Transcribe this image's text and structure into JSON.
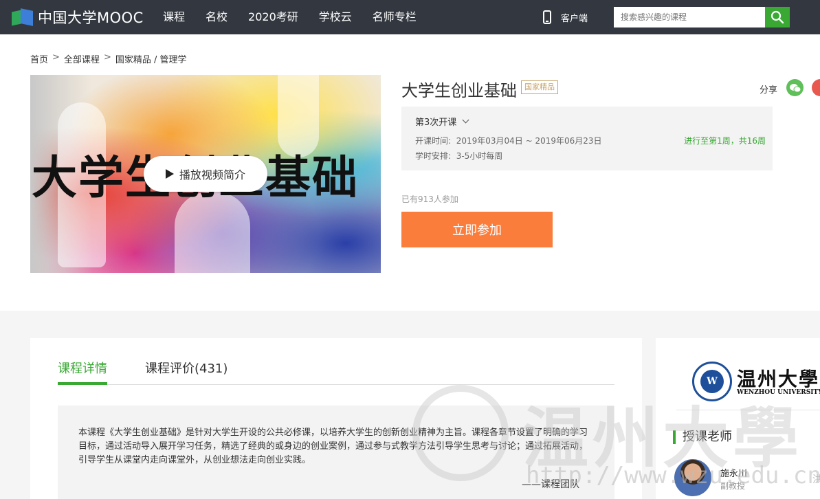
{
  "header": {
    "logo_text": "中国大学MOOC",
    "nav": [
      "课程",
      "名校",
      "2020考研",
      "学校云",
      "名师专栏"
    ],
    "client_label": "客户端",
    "search_placeholder": "搜索感兴趣的课程"
  },
  "breadcrumb": {
    "home": "首页",
    "all_courses": "全部课程",
    "category": "国家精品 / 管理学"
  },
  "cover": {
    "title_text": "大学生创业基础",
    "play_label": "播放视频简介"
  },
  "course": {
    "title": "大学生创业基础",
    "badge": "国家精品",
    "share_label": "分享",
    "term": "第3次开课",
    "start_time_label": "开课时间:",
    "start_time_value": "2019年03月04日 ~ 2019年06月23日",
    "schedule_label": "学时安排:",
    "schedule_value": "3-5小时每周",
    "progress": "进行至第1周，共16周",
    "enrolled": "已有913人参加",
    "join_label": "立即参加"
  },
  "tabs": [
    "课程详情",
    "课程评价(431)"
  ],
  "description": {
    "text": "本课程《大学生创业基础》是针对大学生开设的公共必修课，以培养大学生的创新创业精神为主旨。课程各章节设置了明确的学习目标，通过活动导入展开学习任务，精选了经典的或身边的创业案例，通过参与式教学方法引导学生思考与讨论；通过拓展活动，引导学生从课堂内走向课堂外，从创业想法走向创业实践。",
    "signature": "——课程团队"
  },
  "sidebar": {
    "university_name": "温州大學",
    "university_en": "WENZHOU UNIVERSITY",
    "teachers_title": "授课老师",
    "teacher_name": "施永川",
    "teacher_title": "副教授",
    "more_text": "洪"
  },
  "watermark": {
    "text": "温州大學",
    "url": "http://www.wzu.edu.cn"
  },
  "colors": {
    "nav_bg": "#333840",
    "accent_green": "#39a934",
    "join_orange": "#fb7d3c",
    "badge_gold": "#c8a46a"
  }
}
